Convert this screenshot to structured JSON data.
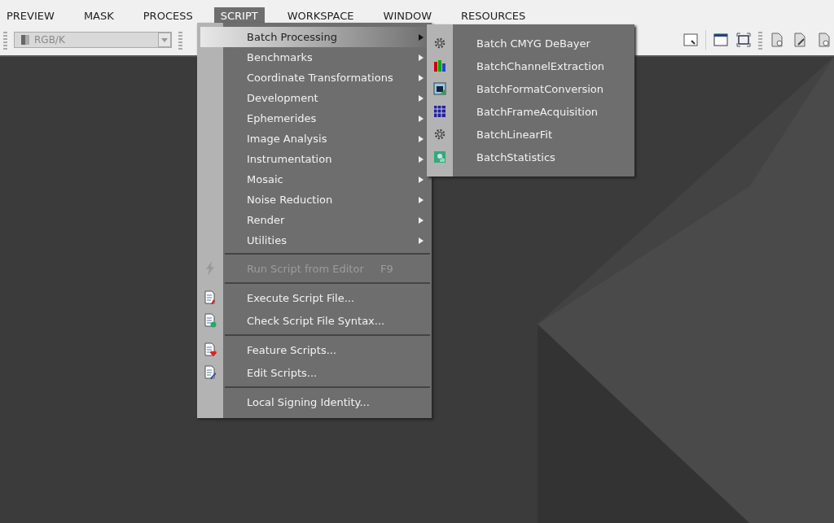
{
  "menubar": [
    {
      "label": "PREVIEW",
      "selected": false
    },
    {
      "label": "MASK",
      "selected": false
    },
    {
      "label": "PROCESS",
      "selected": false
    },
    {
      "label": "SCRIPT",
      "selected": true
    },
    {
      "label": "WORKSPACE",
      "selected": false
    },
    {
      "label": "WINDOW",
      "selected": false
    },
    {
      "label": "RESOURCES",
      "selected": false
    }
  ],
  "toolbar": {
    "channel_select": {
      "value": "RGB/K",
      "disabled": true
    }
  },
  "script_menu": [
    {
      "kind": "submenu",
      "label": "Batch Processing",
      "selected": true
    },
    {
      "kind": "submenu",
      "label": "Benchmarks",
      "selected": false
    },
    {
      "kind": "submenu",
      "label": "Coordinate Transformations",
      "selected": false
    },
    {
      "kind": "submenu",
      "label": "Development",
      "selected": false
    },
    {
      "kind": "submenu",
      "label": "Ephemerides",
      "selected": false
    },
    {
      "kind": "submenu",
      "label": "Image Analysis",
      "selected": false
    },
    {
      "kind": "submenu",
      "label": "Instrumentation",
      "selected": false
    },
    {
      "kind": "submenu",
      "label": "Mosaic",
      "selected": false
    },
    {
      "kind": "submenu",
      "label": "Noise Reduction",
      "selected": false
    },
    {
      "kind": "submenu",
      "label": "Render",
      "selected": false
    },
    {
      "kind": "submenu",
      "label": "Utilities",
      "selected": false
    },
    {
      "kind": "separator"
    },
    {
      "kind": "action",
      "label": "Run Script from Editor",
      "shortcut": "F9",
      "disabled": true,
      "selected": false
    },
    {
      "kind": "separator"
    },
    {
      "kind": "action",
      "label": "Execute Script File...",
      "disabled": false,
      "selected": false
    },
    {
      "kind": "action",
      "label": "Check Script File Syntax...",
      "disabled": false,
      "selected": false
    },
    {
      "kind": "separator"
    },
    {
      "kind": "action",
      "label": "Feature Scripts...",
      "disabled": false,
      "selected": false
    },
    {
      "kind": "action",
      "label": "Edit Scripts...",
      "disabled": false,
      "selected": false
    },
    {
      "kind": "separator"
    },
    {
      "kind": "action",
      "label": "Local Signing Identity...",
      "disabled": false,
      "selected": false
    }
  ],
  "batch_submenu": [
    {
      "label": "Batch CMYG DeBayer"
    },
    {
      "label": "BatchChannelExtraction"
    },
    {
      "label": "BatchFormatConversion"
    },
    {
      "label": "BatchFrameAcquisition"
    },
    {
      "label": "BatchLinearFit"
    },
    {
      "label": "BatchStatistics"
    }
  ]
}
